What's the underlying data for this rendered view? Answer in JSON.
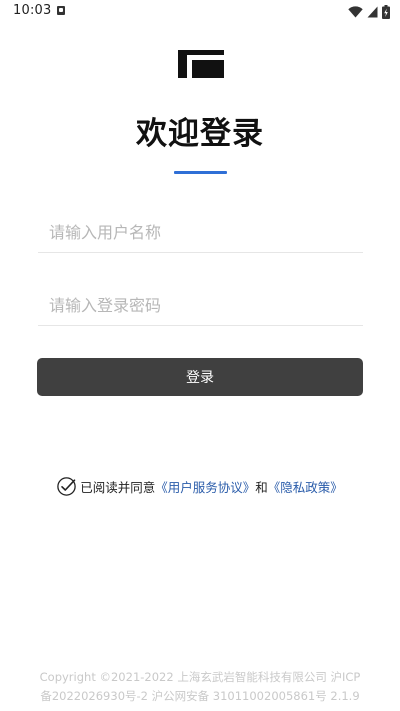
{
  "status_bar": {
    "time": "10:03",
    "notification_icon": "app-notification-icon",
    "wifi_icon": "wifi-icon",
    "signal_icon": "cell-signal-icon",
    "battery_icon": "battery-icon"
  },
  "logo": {
    "icon": "brand-logo-icon"
  },
  "title": "欢迎登录",
  "accent_color": "#2f6fd6",
  "form": {
    "username_placeholder": "请输入用户名称",
    "username_value": "",
    "password_placeholder": "请输入登录密码",
    "password_value": "",
    "login_label": "登录",
    "button_color": "#404040"
  },
  "agreement": {
    "checked": true,
    "prefix": "已阅读并同意",
    "user_agreement": "《用户服务协议》",
    "conjunction": "和",
    "privacy_policy": "《隐私政策》",
    "link_color": "#2a5caa"
  },
  "footer": {
    "line1": "Copyright ©2021-2022 上海玄武岩智能科技有限公司 沪ICP",
    "line2": "备2022026930号-2 沪公网安备 31011002005861号 2.1.9"
  }
}
